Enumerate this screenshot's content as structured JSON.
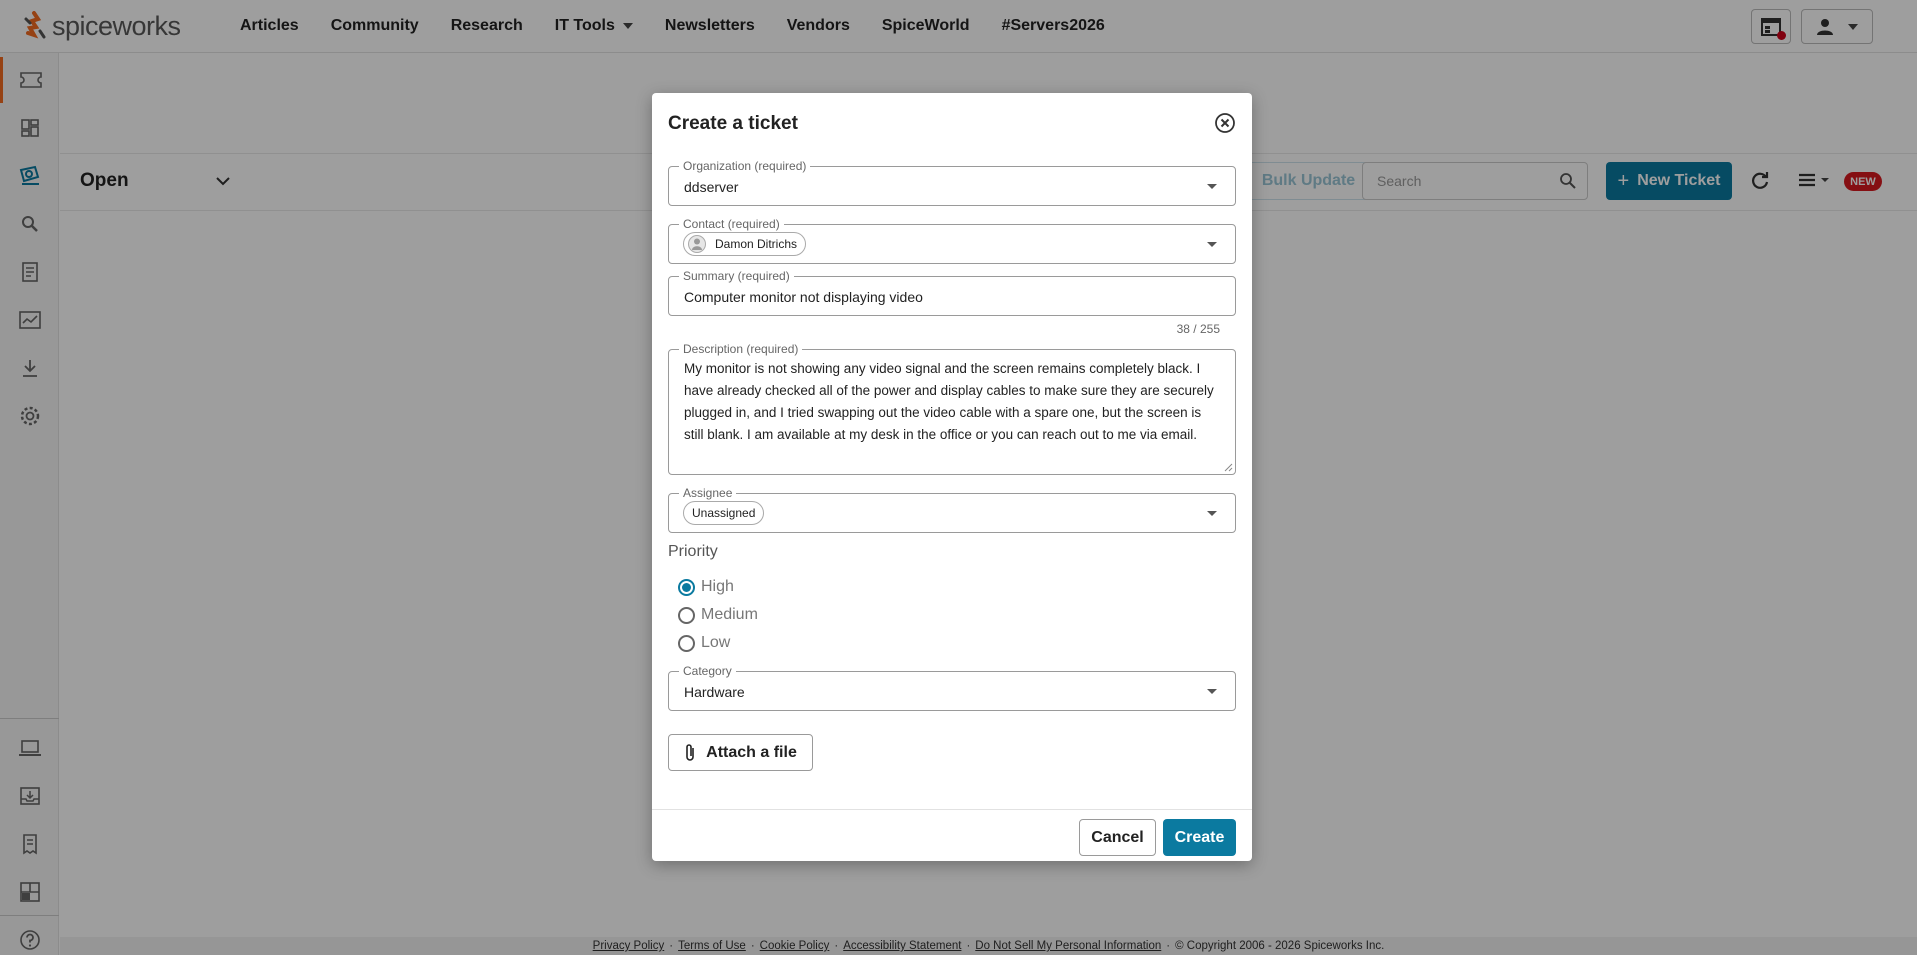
{
  "brand": {
    "name": "spiceworks",
    "accent": "#f26b21",
    "primary": "#0b7aa0"
  },
  "nav": {
    "links": [
      "Articles",
      "Community",
      "Research",
      "IT Tools",
      "Newsletters",
      "Vendors",
      "SpiceWorld",
      "#Servers2026"
    ]
  },
  "sidebar": {
    "icons": [
      "ticket-icon",
      "dashboard-icon",
      "helpdesk-icon",
      "search-icon",
      "reports-icon",
      "monitor-icon",
      "download-icon",
      "settings-icon",
      "laptop-icon",
      "inbox-icon",
      "document-icon",
      "layout-icon",
      "help-icon"
    ]
  },
  "main": {
    "view": "Open",
    "bulk_update": "Bulk Update",
    "search_placeholder": "Search",
    "new_ticket": "New Ticket",
    "new_badge": "NEW"
  },
  "modal": {
    "title": "Create a ticket",
    "organization": {
      "label": "Organization (required)",
      "value": "ddserver"
    },
    "contact": {
      "label": "Contact (required)",
      "value": "Damon Ditrichs"
    },
    "summary": {
      "label": "Summary (required)",
      "value": "Computer monitor not displaying video",
      "counter": "38 / 255"
    },
    "description": {
      "label": "Description (required)",
      "value": "My monitor is not showing any video signal and the screen remains completely black. I have already checked all of the power and display cables to make sure they are securely plugged in, and I tried swapping out the video cable with a spare one, but the screen is still blank. I am available at my desk in the office or you can reach out to me via email."
    },
    "assignee": {
      "label": "Assignee",
      "value": "Unassigned"
    },
    "priority": {
      "label": "Priority",
      "options": [
        "High",
        "Medium",
        "Low"
      ],
      "selected": "High"
    },
    "category": {
      "label": "Category",
      "value": "Hardware"
    },
    "attach": "Attach a file",
    "cancel": "Cancel",
    "create": "Create"
  },
  "footer": {
    "links": [
      "Privacy Policy",
      "Terms of Use",
      "Cookie Policy",
      "Accessibility Statement",
      "Do Not Sell My Personal Information"
    ],
    "copyright": "© Copyright 2006 - 2026 Spiceworks Inc."
  }
}
